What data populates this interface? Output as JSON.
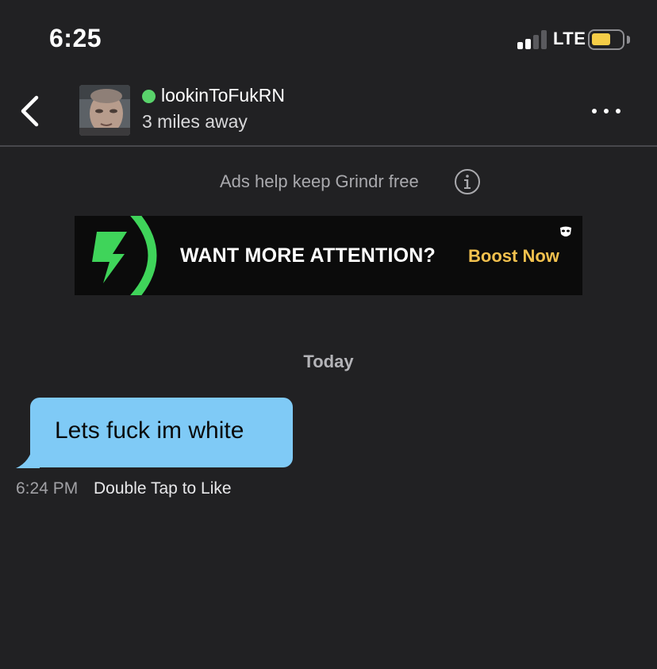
{
  "status_bar": {
    "time": "6:25",
    "network": "LTE",
    "battery_level": 0.65,
    "battery_color": "#f5cd47"
  },
  "header": {
    "back_icon": "chevron-left-icon",
    "profile_name": "lookinToFukRN",
    "distance": "3 miles away",
    "online_color": "#59d36b",
    "more_icon": "ellipsis-icon"
  },
  "ads": {
    "notice": "Ads help keep Grindr free",
    "info_icon": "info-icon",
    "headline": "WANT MORE ATTENTION?",
    "cta": "Boost Now",
    "cta_color": "#f2c14e",
    "accent_color": "#3fd45a"
  },
  "conversation": {
    "date_label": "Today",
    "messages": [
      {
        "text": "Lets fuck im white",
        "time": "6:24 PM",
        "hint": "Double Tap to Like",
        "bubble_color": "#7fcaf6"
      }
    ]
  }
}
